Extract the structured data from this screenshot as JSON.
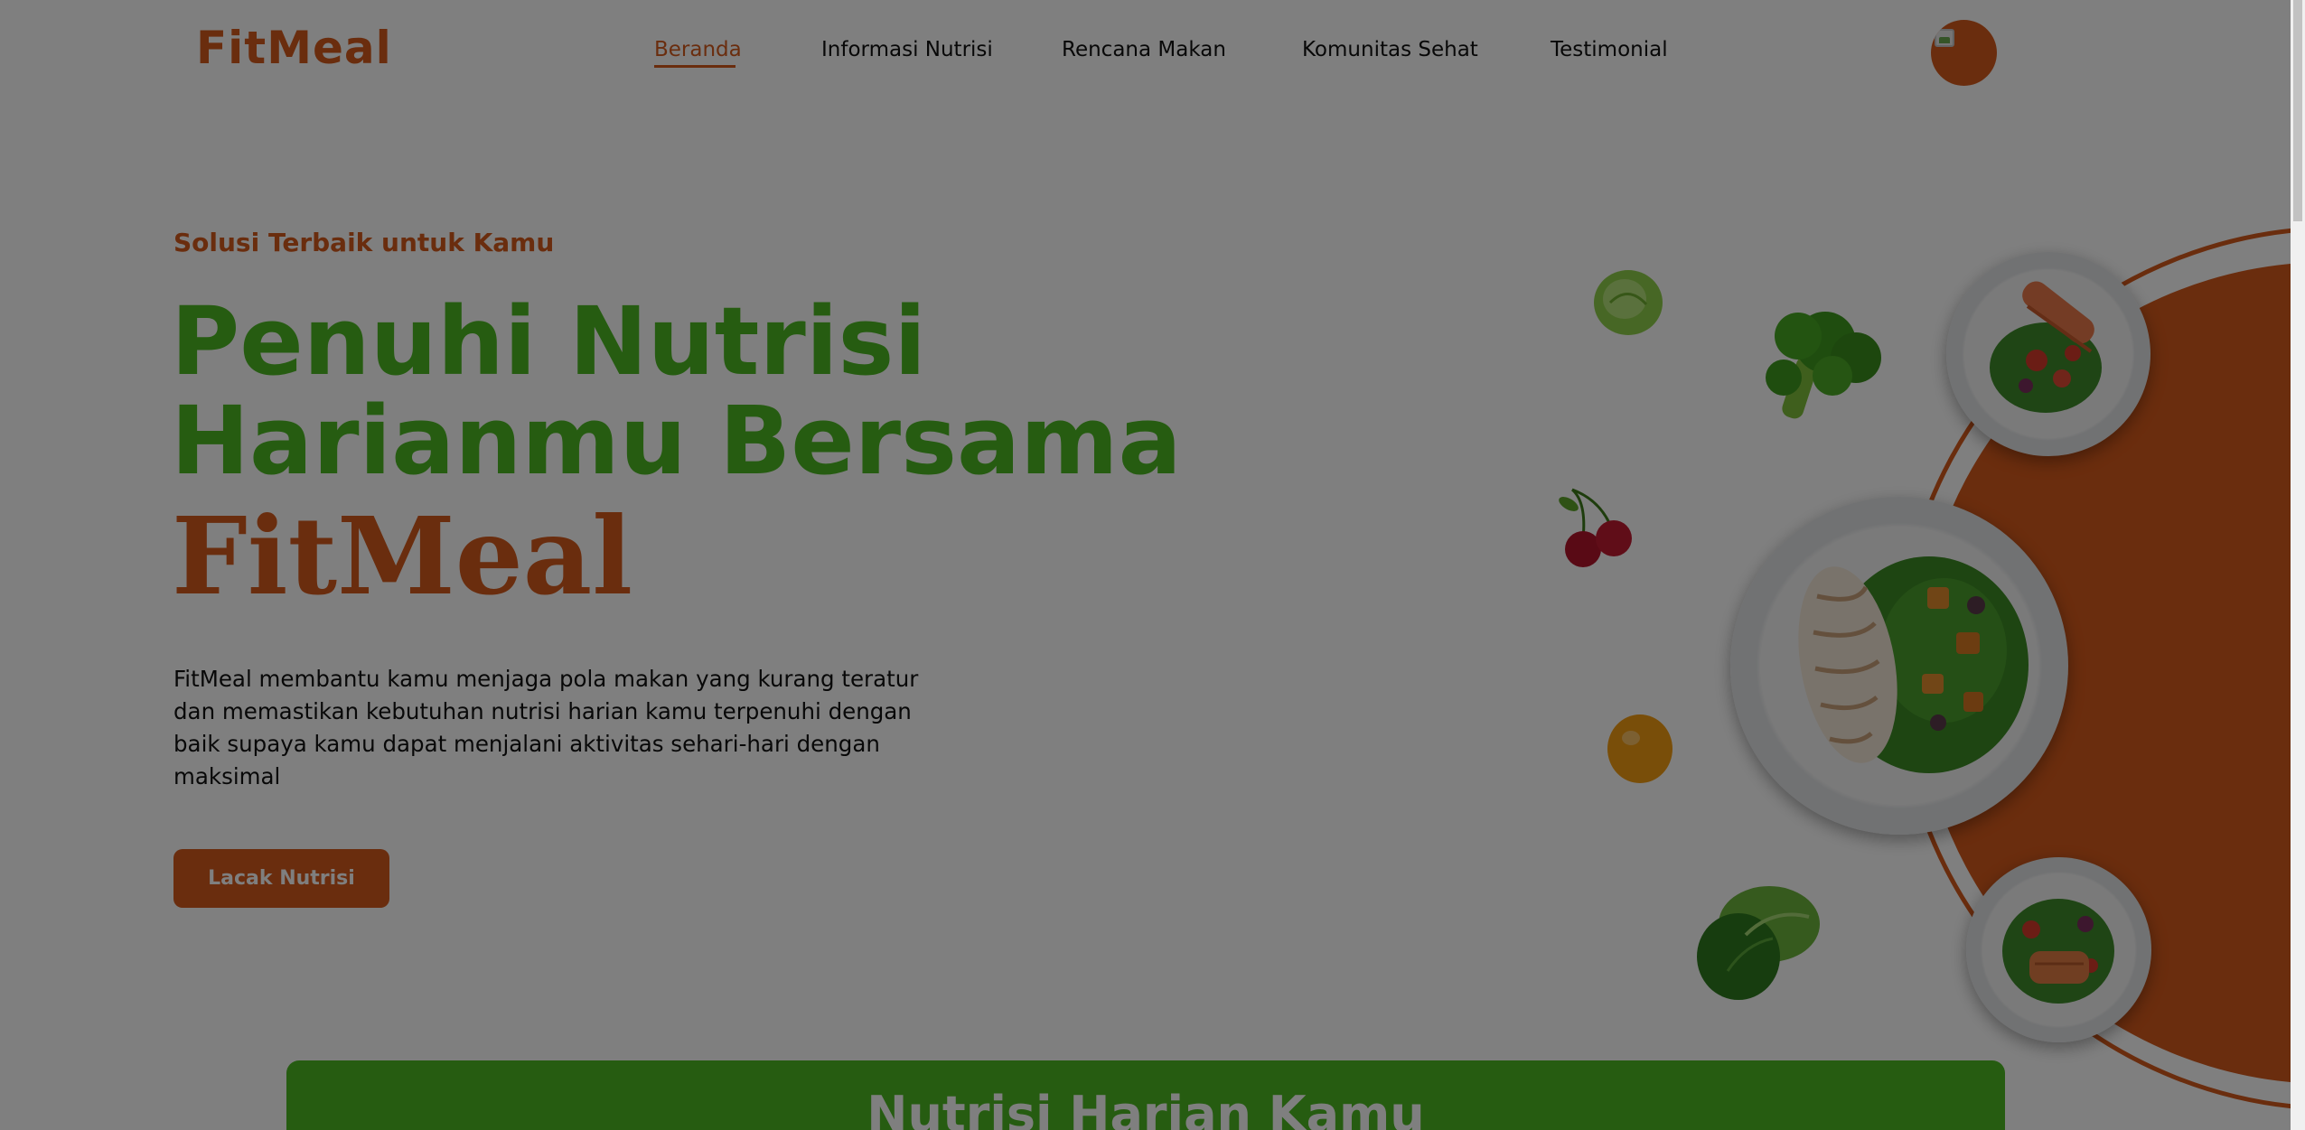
{
  "brand": {
    "logo_text": "FitMeal"
  },
  "nav": {
    "items": [
      {
        "label": "Beranda",
        "active": true
      },
      {
        "label": "Informasi Nutrisi",
        "active": false
      },
      {
        "label": "Rencana Makan",
        "active": false
      },
      {
        "label": "Komunitas Sehat",
        "active": false
      },
      {
        "label": "Testimonial",
        "active": false
      }
    ]
  },
  "hero": {
    "tagline": "Solusi Terbaik untuk Kamu",
    "title_line1": "Penuhi Nutrisi",
    "title_line2": "Harianmu Bersama",
    "title_brand": "FitMeal",
    "description": "FitMeal membantu kamu menjaga pola makan yang kurang teratur dan memastikan kebutuhan nutrisi harian kamu terpenuhi dengan baik supaya kamu dapat menjalani aktivitas sehari-hari dengan maksimal",
    "cta_label": "Lacak Nutrisi"
  },
  "nutrition_section": {
    "title": "Nutrisi Harian Kamu"
  },
  "colors": {
    "brand_orange": "#d55a1c",
    "brand_green": "#4cb923",
    "overlay": "rgba(0,0,0,0.5)"
  },
  "icons": {
    "avatar": "broken-image-avatar",
    "decor": [
      "lettuce-icon",
      "broccoli-icon",
      "cherries-icon",
      "orange-icon",
      "cabbage-icon"
    ]
  }
}
